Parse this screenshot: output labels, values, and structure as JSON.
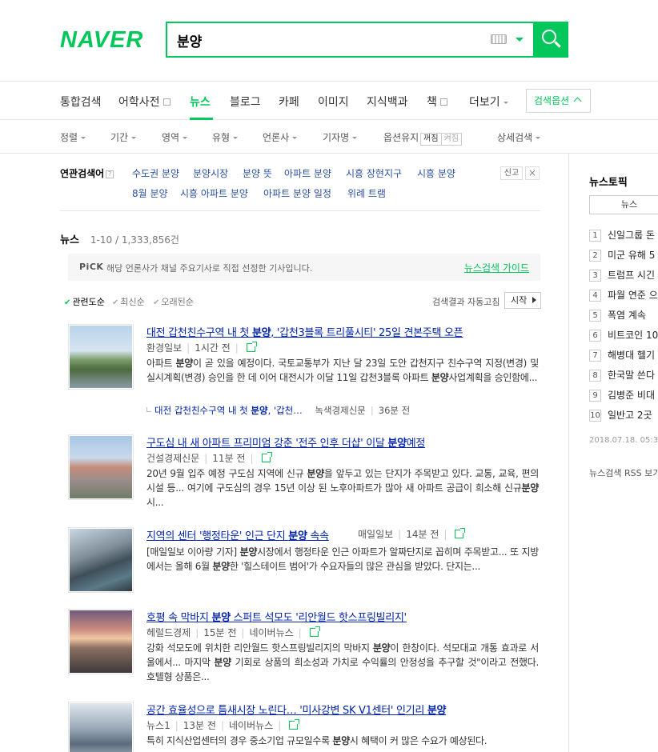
{
  "header": {
    "logo": "NAVER",
    "search_value": "분양"
  },
  "tabs": [
    {
      "label": "통합검색"
    },
    {
      "label": "어학사전"
    },
    {
      "label": "뉴스"
    },
    {
      "label": "블로그"
    },
    {
      "label": "카페"
    },
    {
      "label": "이미지"
    },
    {
      "label": "지식백과"
    },
    {
      "label": "책"
    },
    {
      "label": "더보기"
    }
  ],
  "search_options_label": "검색옵션",
  "filters": {
    "sort": "정렬",
    "period": "기간",
    "area": "영역",
    "type": "유형",
    "press": "언론사",
    "reporter": "기자명",
    "option_keep": "옵션유지",
    "on": "꺼짐",
    "off": "켜짐",
    "detail": "상세검색"
  },
  "related": {
    "label": "연관검색어",
    "help": "?",
    "terms": [
      "수도권 분양",
      "분양시장",
      "분양 뜻",
      "아파트 분양",
      "시흥 장현지구",
      "시흥 분양",
      "8월 분양",
      "시흥 아파트 분양",
      "아파트 분양 일정",
      "위례 트램"
    ],
    "report": "신고",
    "close": "×"
  },
  "news": {
    "label": "뉴스",
    "count": "1-10 / 1,333,856건"
  },
  "pick": {
    "badge": "PiCK",
    "text": "해당 언론사가 채널 주요기사로 직접 선정한 기사입니다.",
    "guide": "뉴스검색 가이드"
  },
  "sort_options": {
    "relevance": "관련도순",
    "latest": "최신순",
    "oldest": "오래된순",
    "auto_refresh": "검색결과 자동고침",
    "start": "시작"
  },
  "items": [
    {
      "title_pre": "대전 갑천친수구역 내 첫 ",
      "title_kw": "분양",
      "title_post": ", '갑천3블록 트리풀시티' 25일 견본주택 오픈",
      "source": "환경일보",
      "time": "1시간 전",
      "desc": [
        {
          "t": "아파트 "
        },
        {
          "b": "분양"
        },
        {
          "t": "이 곧 있을 예정이다. 국토교통부가 지난 달 23일 도안 갑천지구 친수구역 지정(변경) 및 실시계획(변경) 승인을 한 데 이어 대전시가 이달 11일 갑천3블록 아파트 "
        },
        {
          "b": "분양"
        },
        {
          "t": "사업계획을 승인함에..."
        }
      ],
      "related_pre": "대전 갑천친수구역 내 첫 ",
      "related_kw": "분양",
      "related_post": ", '갑천…",
      "related_source": "녹색경제신문",
      "related_time": "36분 전"
    },
    {
      "title_pre": "구도심 내 새 아파트 프리미엄 강춘 '전주 인후 더샵' 이달 ",
      "title_kw": "분양",
      "title_post": "예정",
      "source": "건설경제신문",
      "time": "11분 전",
      "desc": [
        {
          "t": "20년 9월 입주 예정 구도심 지역에 신규 "
        },
        {
          "b": "분양"
        },
        {
          "t": "을 앞두고 있는 단지가 주목받고 있다. 교통, 교육, 편의시설 등... 여기에 구도심의 경우 15년 이상 된 노후아파트가 많아 새 아파트 공급이 희소해 신규"
        },
        {
          "b": "분양"
        },
        {
          "t": " 시..."
        }
      ]
    },
    {
      "title_pre": "지역의 센터 '행정타운' 인근 단지 ",
      "title_kw": "분양",
      "title_post": " 속속",
      "source": "매일일보",
      "time": "14분 전",
      "desc": [
        {
          "t": "[매일일보 이아량 기자] "
        },
        {
          "b": "분양"
        },
        {
          "t": "시장에서 행정타운 인근 아파트가 알짜단지로 꼽히며 주목받고... 또 지방에서는 올해 6월 "
        },
        {
          "b": "분양"
        },
        {
          "t": "한 '힐스테이트 범어'가 수요자들의 많은 관심을 받았다.  단지는..."
        }
      ]
    },
    {
      "title_pre": "호평 속 막바지 ",
      "title_kw": "분양",
      "title_post": " 스퍼트 석모도 '리안월드 핫스프링빌리지'",
      "source": "헤럴드경제",
      "time": "15분 전",
      "portal": "네이버뉴스",
      "desc": [
        {
          "t": "강화 석모도에 위치한 리안월드 핫스프링빌리지의 막바지 "
        },
        {
          "b": "분양"
        },
        {
          "t": "이 한창이다. 석모대교 개통 효과로 서울에서... 마지막 "
        },
        {
          "b": "분양"
        },
        {
          "t": " 기회로 상품의 희소성과 가치로 수익률의 안정성을 추구할 것\"이라고 전했다. 호텔형 상품은..."
        }
      ]
    },
    {
      "title_pre": "공간 효율성으로 틈새시장 노린다… '미사강변 SK V1센터' 인기리 ",
      "title_kw": "분양",
      "title_post": "",
      "source": "뉴스1",
      "time": "13분 전",
      "portal": "네이버뉴스",
      "desc": [
        {
          "t": "특히 지식산업센터의 경우 중소기업 규모일수록 "
        },
        {
          "b": "분양"
        },
        {
          "t": "시 혜택이 커 많은 수요가 예상된다."
        }
      ]
    }
  ],
  "side": {
    "title": "뉴스토픽",
    "tab": "뉴스",
    "topics": [
      "신일그룹 돈",
      "미군 유해 5",
      "트럼프 시긴",
      "파월 연준 으",
      "폭염 계속",
      "비트코인 10",
      "해병대 헬기",
      "한국말 쓴다",
      "김병준 비대",
      "일반고 2곳"
    ],
    "date": "2018.07.18. 05:3",
    "rss": "뉴스검색 RSS 보기"
  },
  "colors": {
    "brand": "#03c75a",
    "link": "#0022aa",
    "related_link": "#2a4fa5"
  }
}
